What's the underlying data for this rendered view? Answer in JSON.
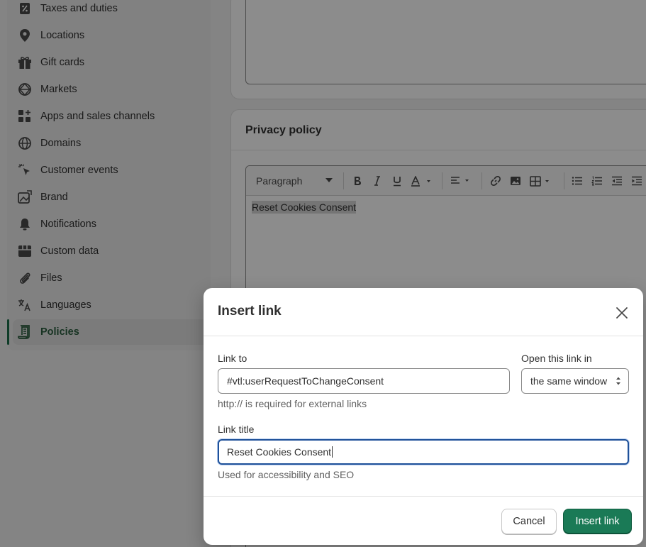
{
  "sidebar": {
    "items": [
      {
        "label": "Taxes and duties",
        "icon": "percent-tag-icon"
      },
      {
        "label": "Locations",
        "icon": "location-pin-icon"
      },
      {
        "label": "Gift cards",
        "icon": "gift-icon"
      },
      {
        "label": "Markets",
        "icon": "globe-grid-icon"
      },
      {
        "label": "Apps and sales channels",
        "icon": "apps-icon"
      },
      {
        "label": "Domains",
        "icon": "globe-icon"
      },
      {
        "label": "Customer events",
        "icon": "cursor-click-icon"
      },
      {
        "label": "Brand",
        "icon": "brand-image-icon"
      },
      {
        "label": "Notifications",
        "icon": "bell-icon"
      },
      {
        "label": "Custom data",
        "icon": "database-icon"
      },
      {
        "label": "Files",
        "icon": "paperclip-icon"
      },
      {
        "label": "Languages",
        "icon": "translate-icon"
      },
      {
        "label": "Policies",
        "icon": "policy-document-icon",
        "active": true
      }
    ]
  },
  "privacy": {
    "title": "Privacy policy",
    "toolbar": {
      "block_type": "Paragraph"
    },
    "content": "Reset Cookies Consent"
  },
  "modal": {
    "title": "Insert link",
    "link_to_label": "Link to",
    "link_to_value": "#vtl:userRequestToChangeConsent",
    "link_to_help": "http:// is required for external links",
    "open_in_label": "Open this link in",
    "open_in_value": "the same window",
    "link_title_label": "Link title",
    "link_title_value": "Reset Cookies Consent",
    "link_title_help": "Used for accessibility and SEO",
    "cancel_label": "Cancel",
    "insert_label": "Insert link"
  },
  "colors": {
    "primary_button": "#1a7a56",
    "focus_ring": "#1f5199",
    "active_nav": "#2b5d3f"
  }
}
